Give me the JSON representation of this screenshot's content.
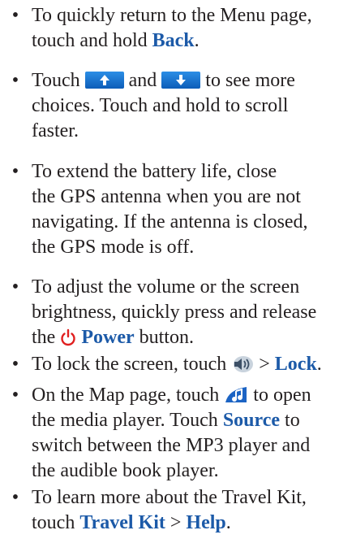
{
  "tips": [
    {
      "line1_prefix": "To quickly return to the Menu page,",
      "line2_prefix": "touch and hold ",
      "kw_back": "Back",
      "line2_suffix": "."
    },
    {
      "t_touch": "Touch",
      "t_and": "and",
      "t_see": "to see more",
      "line2": "choices. Touch and hold to scroll",
      "line3": "faster."
    },
    {
      "line1": "To extend the battery life, close",
      "line2": "the GPS antenna when you are not",
      "line3": "navigating. If the antenna is closed,",
      "line4": "the GPS mode is off."
    },
    {
      "line1": "To adjust the volume or the screen",
      "line2": "brightness, quickly press and release",
      "line3_prefix": "the ",
      "kw_power": "Power",
      "line3_suffix": " button."
    },
    {
      "prefix": "To lock the screen, touch ",
      "gt": " > ",
      "kw_lock": "Lock",
      "suffix": "."
    },
    {
      "line1_prefix": "On the Map page, touch ",
      "line1_suffix": " to open",
      "line2_prefix": "the media player. Touch ",
      "kw_source": "Source",
      "line2_suffix": " to",
      "line3": "switch between the MP3 player and",
      "line4": "the audible book player."
    },
    {
      "line1": "To learn more about the Travel Kit,",
      "line2_prefix": "touch ",
      "kw_travel": "Travel Kit",
      "gt": " > ",
      "kw_help": "Help",
      "line2_suffix": "."
    }
  ],
  "icons": {
    "up_arrow": "up-arrow-button-icon",
    "down_arrow": "down-arrow-button-icon",
    "power": "power-icon",
    "volume": "volume-speaker-icon",
    "media": "music-note-icon"
  },
  "colors": {
    "text": "#231f20",
    "keyword": "#1c5aa8",
    "power": "#e02020",
    "button": "#1a73d0"
  }
}
